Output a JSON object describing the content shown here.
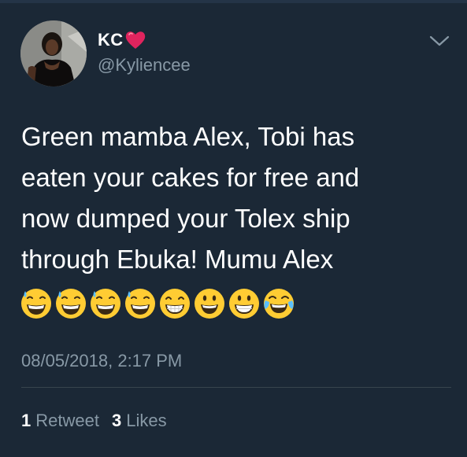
{
  "user": {
    "display_name": "KC",
    "handle": "@Kyliencee",
    "name_emoji": "heart-icon"
  },
  "tweet": {
    "lines": [
      "Green mamba Alex, Tobi has",
      "eaten your cakes for free and",
      "now dumped your Tolex ship",
      "through Ebuka! Mumu Alex"
    ],
    "emojis": [
      "grinning-sweat-emoji",
      "grinning-sweat-emoji",
      "grinning-sweat-emoji",
      "grinning-sweat-emoji",
      "beaming-grin-emoji",
      "smiley-emoji",
      "grinning-emoji",
      "tears-of-joy-emoji"
    ],
    "timestamp": "08/05/2018, 2:17 PM"
  },
  "stats": {
    "retweets_count": "1",
    "retweets_label": "Retweet",
    "likes_count": "3",
    "likes_label": "Likes"
  },
  "colors": {
    "background": "#1b2836",
    "secondary_text": "#8899a6",
    "divider": "#38444d",
    "heart": "#e0245e",
    "emoji_yellow": "#ffcc33"
  }
}
